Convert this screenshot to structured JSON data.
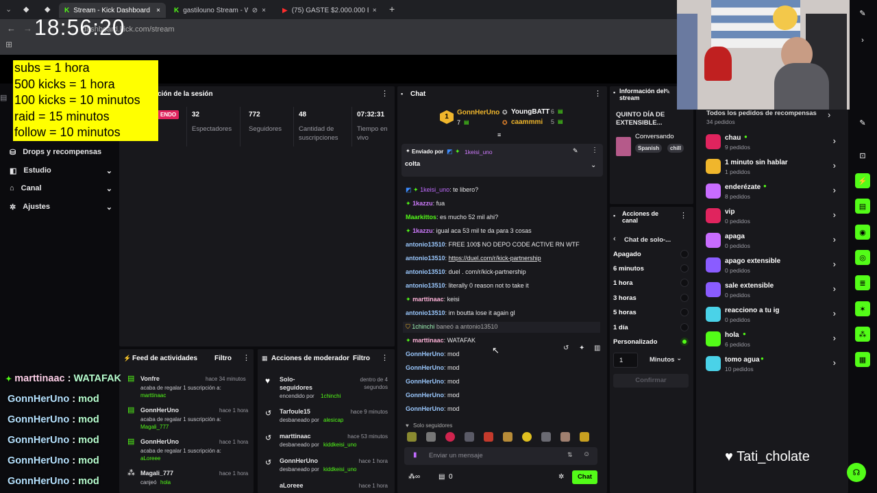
{
  "clock": "18:56:20",
  "browser": {
    "tabs": [
      {
        "title": "Stream - Kick Dashboard",
        "active": true
      },
      {
        "title": "gastilouno Stream - Watch",
        "active": false
      },
      {
        "title": "(75) GASTE $2.000.000 EN EL C",
        "active": false
      }
    ],
    "url": "dashboard.kick.com/stream"
  },
  "rules_overlay": {
    "lines": [
      "subs = 1 hora",
      "500 kicks = 1 hora",
      "100 kicks = 10 minutos",
      "raid = 15 minutos",
      "follow = 10 minutos"
    ]
  },
  "sidebar": {
    "items": [
      {
        "label": "Drops y recompensas"
      },
      {
        "label": "Estudio"
      },
      {
        "label": "Canal"
      },
      {
        "label": "Ajustes"
      }
    ]
  },
  "session": {
    "title": "ción de la sesión",
    "live_badge": "ENDO",
    "stats": [
      {
        "value": "32",
        "label": "Espectadores"
      },
      {
        "value": "772",
        "label": "Seguidores"
      },
      {
        "value": "48",
        "label": "Cantidad de suscripciones"
      },
      {
        "value": "07:32:31",
        "label": "Tiempo en vivo"
      }
    ]
  },
  "chat": {
    "title": "Chat",
    "leaderboard": [
      {
        "rank": "1",
        "name": "GonnHerUno",
        "value": "7"
      },
      {
        "name": "YoungBATT",
        "value": "6"
      },
      {
        "name": "caammmi",
        "value": "5"
      }
    ],
    "pinned": {
      "label": "Enviado por",
      "user": "1keisi_uno",
      "message": "colta"
    },
    "messages": [
      {
        "user": "1keisi_uno",
        "text": "te libero?",
        "color": "purple"
      },
      {
        "user": "1kazzu",
        "text": "fua",
        "color": "purple"
      },
      {
        "user": "Maarkittos",
        "text": "es mucho 52 mil ahi?",
        "color": "mint"
      },
      {
        "user": "1kazzu",
        "text": "igual aca 53 mil te da para 3 cosas",
        "color": "purple"
      },
      {
        "user": "antonio13510",
        "text": "FREE 100$ NO DEPO CODE ACTIVE RN WTF",
        "color": "blue"
      },
      {
        "user": "antonio13510",
        "text": "https://duel.com/r/kick-partnership",
        "color": "blue",
        "link": true
      },
      {
        "user": "antonio13510",
        "text": "duel . com/r/kick-partnership",
        "color": "blue"
      },
      {
        "user": "antonio13510",
        "text": "literally 0 reason not to take it",
        "color": "blue"
      },
      {
        "user": "marttinaac",
        "text": "keisi",
        "color": "pink"
      },
      {
        "user": "antonio13510",
        "text": "im boutta lose it again gl",
        "color": "blue"
      },
      {
        "user": "1chinchi",
        "text": "baneó a antonio13510",
        "color": "mint",
        "system": true
      },
      {
        "user": "marttinaac",
        "text": "WATAFAK",
        "color": "pink"
      },
      {
        "user": "GonnHerUno",
        "text": "mod",
        "color": "blue"
      },
      {
        "user": "GonnHerUno",
        "text": "mod",
        "color": "blue"
      },
      {
        "user": "GonnHerUno",
        "text": "mod",
        "color": "blue"
      },
      {
        "user": "GonnHerUno",
        "text": "mod",
        "color": "blue"
      },
      {
        "user": "GonnHerUno",
        "text": "mod",
        "color": "blue"
      }
    ],
    "followers_only": "Solo seguidores",
    "input_placeholder": "Enviar un mensaje",
    "footer_count": "0",
    "send_label": "Chat"
  },
  "stream_info": {
    "title": "Información del stream",
    "stream_title": "QUINTO DÍA DE EXTENSIBLE...",
    "category": "Conversando",
    "tags": [
      "Spanish",
      "chill"
    ]
  },
  "channel_actions": {
    "title": "Acciones de canal",
    "submenu": "Chat de solo-...",
    "options": [
      "Apagado",
      "6 minutos",
      "1 hora",
      "3 horas",
      "5 horas",
      "1 día",
      "Personalizado"
    ],
    "selected": "Personalizado",
    "custom_value": "1",
    "unit": "Minutos",
    "confirm": "Confirmar"
  },
  "activity_feed": {
    "title": "Feed de actividades",
    "filter": "Filtro",
    "items": [
      {
        "user": "Vonfre",
        "time": "hace 34 minutos",
        "text": "acaba de regalar 1 suscripción a:",
        "target": "marttinaac"
      },
      {
        "user": "GonnHerUno",
        "time": "hace 1 hora",
        "text": "acaba de regalar 1 suscripción a:",
        "target": "Magali_777"
      },
      {
        "user": "GonnHerUno",
        "time": "hace 1 hora",
        "text": "acaba de regalar 1 suscripción a:",
        "target": "aLoreee"
      },
      {
        "user": "Magali_777",
        "time": "hace 1 hora",
        "text": "canjeó",
        "target": "hola"
      }
    ]
  },
  "mod_actions": {
    "title": "Acciones de moderador",
    "filter": "Filtro",
    "items": [
      {
        "user": "Solo-seguidores",
        "time": "dentro de 4 segundos",
        "text": "encendido por",
        "target": "1chinchi"
      },
      {
        "user": "Tarfoule15",
        "time": "hace 9 minutos",
        "text": "desbaneado por",
        "target": "alesicap"
      },
      {
        "user": "marttinaac",
        "time": "hace 53 minutos",
        "text": "desbaneado por",
        "target": "kiddkeisi_uno"
      },
      {
        "user": "GonnHerUno",
        "time": "hace 1 hora",
        "text": "desbaneado por",
        "target": "kiddkeisi_uno"
      },
      {
        "user": "aLoreee",
        "time": "hace 1 hora",
        "text": "",
        "target": ""
      }
    ]
  },
  "rewards": {
    "header": "Todos los pedidos de recompensas",
    "header_count": "34 pedidos",
    "items": [
      {
        "title": "chau",
        "count": "9 pedidos",
        "color": "#e0245e"
      },
      {
        "title": "1 minuto sin hablar",
        "count": "1 pedidos",
        "color": "#f0b62c"
      },
      {
        "title": "enderézate",
        "count": "8 pedidos",
        "color": "#c86cff"
      },
      {
        "title": "vip",
        "count": "0 pedidos",
        "color": "#e0245e"
      },
      {
        "title": "apaga",
        "count": "0 pedidos",
        "color": "#c86cff"
      },
      {
        "title": "apago extensible",
        "count": "0 pedidos",
        "color": "#8a5cff"
      },
      {
        "title": "sale extensible",
        "count": "0 pedidos",
        "color": "#8a5cff"
      },
      {
        "title": "reacciono a tu ig",
        "count": "0 pedidos",
        "color": "#4ad2e8"
      },
      {
        "title": "hola",
        "count": "6 pedidos",
        "color": "#53fc18"
      },
      {
        "title": "tomo agua",
        "count": "10 pedidos",
        "color": "#4ad2e8"
      }
    ]
  },
  "overlay_chat": [
    {
      "user": "marttinaac",
      "text": "WATAFAK"
    },
    {
      "user": "GonnHerUno",
      "text": "mod"
    },
    {
      "user": "GonnHerUno",
      "text": "mod"
    },
    {
      "user": "GonnHerUno",
      "text": "mod"
    },
    {
      "user": "GonnHerUno",
      "text": "mod"
    },
    {
      "user": "GonnHerUno",
      "text": "mod"
    }
  ],
  "streamer_tag": "Tati_cholate",
  "colors": {
    "accent": "#53fc18",
    "panel": "#18181c",
    "background": "#0b0b0e",
    "rules_bg": "#ffff00"
  }
}
